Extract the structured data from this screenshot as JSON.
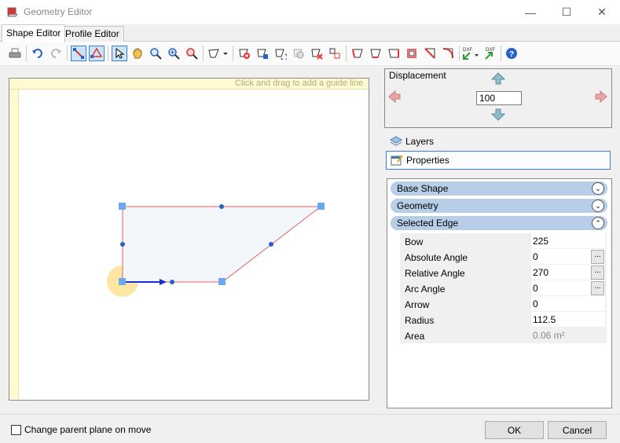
{
  "window": {
    "title": "Geometry Editor",
    "controls": {
      "minimize": "—",
      "maximize": "☐",
      "close": "✕"
    }
  },
  "tabs": [
    {
      "label": "Shape Editor",
      "active": true
    },
    {
      "label": "Profile Editor",
      "active": false
    }
  ],
  "toolbar": {
    "tools": [
      "print-icon",
      "undo-icon",
      "redo-icon",
      "snap-icon",
      "snap-outline-icon",
      "select-icon",
      "pan-icon",
      "zoom-icon",
      "zoom-in-icon",
      "zoom-fit-icon",
      "shape-dropdown-icon",
      "add-point-icon",
      "edit-point-icon",
      "rotate-icon",
      "hide-icon",
      "delete-point-icon",
      "split-icon",
      "edge-1-icon",
      "edge-2-icon",
      "edge-3-icon",
      "edge-4-icon",
      "cut-corner-icon",
      "round-corner-icon",
      "dxf-import-icon",
      "dxf-export-icon",
      "help-icon"
    ],
    "dxf_label": "DXF"
  },
  "canvas": {
    "guide_hint": "Click and drag to add a guide line"
  },
  "displacement": {
    "label": "Displacement",
    "value": "100"
  },
  "side_buttons": {
    "layers": "Layers",
    "properties": "Properties"
  },
  "property_grid": {
    "groups": [
      {
        "label": "Base Shape",
        "expanded": false
      },
      {
        "label": "Geometry",
        "expanded": false
      },
      {
        "label": "Selected Edge",
        "expanded": true
      }
    ],
    "rows": [
      {
        "key": "Bow",
        "value": "225"
      },
      {
        "key": "Absolute Angle",
        "value": "0"
      },
      {
        "key": "Relative Angle",
        "value": "270"
      },
      {
        "key": "Arc Angle",
        "value": "0"
      },
      {
        "key": "Arrow",
        "value": "0"
      },
      {
        "key": "Radius",
        "value": "112.5"
      },
      {
        "key": "Area",
        "value": "0.06 m²"
      }
    ],
    "ellipsis": "..."
  },
  "footer": {
    "checkbox_label": "Change parent plane on move",
    "checked": false,
    "ok": "OK",
    "cancel": "Cancel"
  },
  "colors": {
    "accent": "#3a7fd5",
    "group_header": "#b7cde8",
    "shape_fill": "#f3f6fb",
    "shape_edge": "#e06060",
    "handle": "#6aa8ef",
    "selected_edge": "#1a2dd9",
    "highlight": "#fde5a2"
  }
}
